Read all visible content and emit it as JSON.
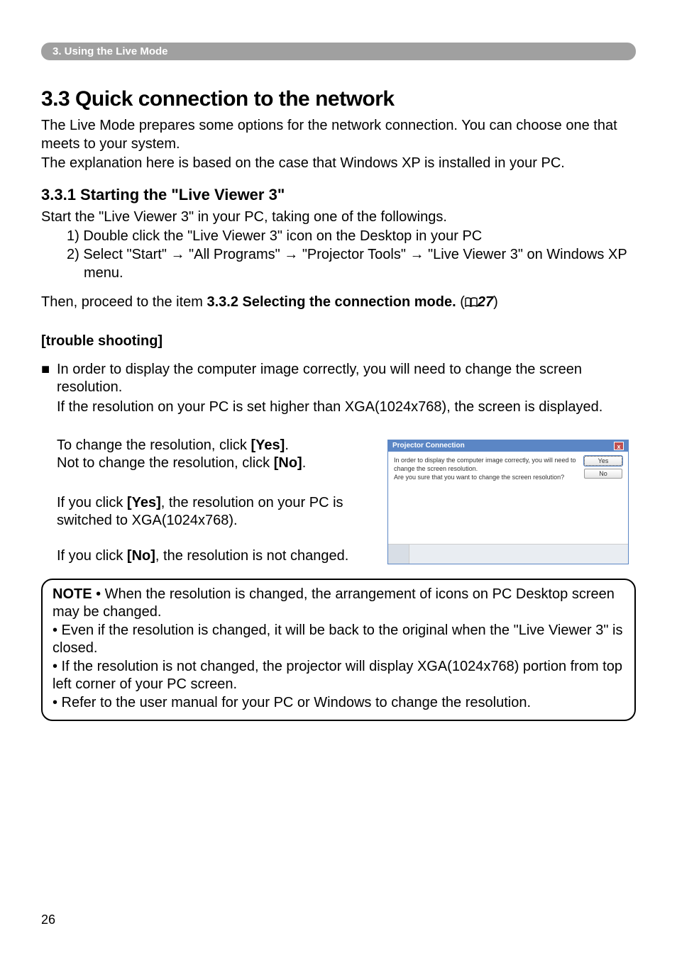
{
  "section_tab": "3. Using the Live Mode",
  "h1": "3.3 Quick connection to the network",
  "intro1": "The Live Mode prepares some options for the network connection. You can choose one that meets to your system.",
  "intro2": "The explanation here is based on the case that Windows XP is installed in your PC.",
  "h2": "3.3.1 Starting the \"Live Viewer 3\"",
  "start_line": "Start the \"Live Viewer 3\" in your PC, taking one of the followings.",
  "step1": "1) Double click the \"Live Viewer 3\" icon on the Desktop in your PC",
  "step2": "2) Select \"Start\" → \"All Programs\" → \"Projector Tools\" → \"Live Viewer 3\" on Windows XP menu.",
  "then_pre": "Then, proceed to the item ",
  "then_bold": "3.3.2 Selecting the connection mode.",
  "then_ref": "27",
  "trouble_head": "[trouble shooting]",
  "bullet1a": "In order to display the computer image correctly, you will need to change the screen resolution.",
  "bullet1b": "If the resolution on your PC is set higher than XGA(1024x768), the screen is displayed.",
  "change1a": "To change the resolution, click ",
  "change1a_bold": "[Yes]",
  "change1a_end": ".",
  "change1b": "Not to change the resolution, click ",
  "change1b_bold": "[No]",
  "change1b_end": ".",
  "yes_text_a": "If you click ",
  "yes_text_bold": "[Yes]",
  "yes_text_b": ", the resolution on your PC is switched to XGA(1024x768).",
  "no_text_a": "If you click ",
  "no_text_bold": "[No]",
  "no_text_b": ", the resolution is not changed.",
  "dialog": {
    "title": "Projector Connection",
    "line1": "In order to display the computer image correctly, you will need to change the screen resolution.",
    "line2": "Are you sure that you want to change the screen resolution?",
    "yes": "Yes",
    "no": "No"
  },
  "note": {
    "label": "NOTE",
    "n1": " • When the resolution is changed, the arrangement of icons on PC Desktop screen may be changed.",
    "n2": "• Even if the resolution is changed, it will be back to the original when the \"Live Viewer 3\" is closed.",
    "n3": "• If the resolution is not changed, the projector will display XGA(1024x768) portion from top left corner of your PC screen.",
    "n4": "• Refer to the user manual for your PC or Windows to change the resolution."
  },
  "page": "26"
}
